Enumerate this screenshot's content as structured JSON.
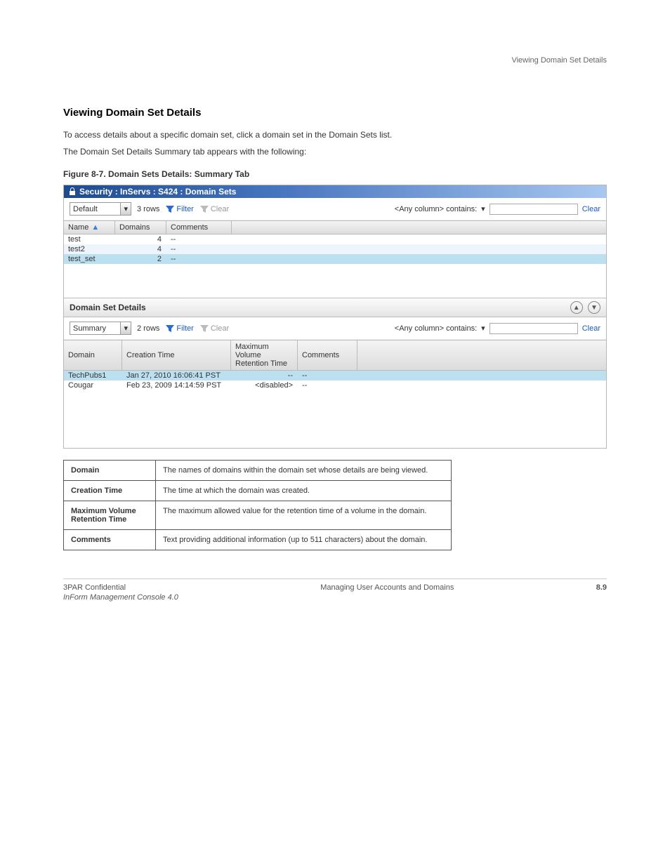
{
  "header": {
    "right": "Viewing Domain Set Details"
  },
  "section": {
    "title": "Viewing Domain Set Details",
    "p1": "To access details about a specific domain set, click a domain set in the Domain Sets list.",
    "p2": "The Domain Set Details Summary tab appears with the following:",
    "figcap": "Figure 8-7.  Domain Sets Details: Summary Tab"
  },
  "panel1": {
    "titlebar": "Security : InServs : S424 : Domain Sets",
    "dropdown": "Default",
    "rows": "3 rows",
    "filter": "Filter",
    "clear": "Clear",
    "filterLabel": "<Any column> contains:",
    "clearLink": "Clear",
    "cols": [
      "Name",
      "Domains",
      "Comments"
    ],
    "data": [
      {
        "name": "test",
        "domains": "4",
        "comments": "--"
      },
      {
        "name": "test2",
        "domains": "4",
        "comments": "--"
      },
      {
        "name": "test_set",
        "domains": "2",
        "comments": "--"
      }
    ]
  },
  "details": {
    "title": "Domain Set Details"
  },
  "panel2": {
    "dropdown": "Summary",
    "rows": "2 rows",
    "filter": "Filter",
    "clear": "Clear",
    "filterLabel": "<Any column> contains:",
    "clearLink": "Clear",
    "cols": [
      "Domain",
      "Creation Time",
      "Maximum Volume Retention Time",
      "Comments"
    ],
    "data": [
      {
        "domain": "TechPubs1",
        "ct": "Jan 27, 2010 16:06:41 PST",
        "mv": "--",
        "cm": "--"
      },
      {
        "domain": "Cougar",
        "ct": "Feb 23, 2009 14:14:59 PST",
        "mv": "<disabled>",
        "cm": "--"
      }
    ]
  },
  "docTable": {
    "rows": [
      [
        "Domain",
        "The names of domains within the domain set whose details are being viewed."
      ],
      [
        "Creation Time",
        "The time at which the domain was created."
      ],
      [
        "Maximum Volume Retention Time",
        "The maximum allowed value for the retention time of a volume in the domain."
      ],
      [
        "Comments",
        "Text providing additional information (up to 511 characters) about the domain."
      ]
    ]
  },
  "footer": {
    "left": "3PAR Confidential",
    "mid": "Managing User Accounts and Domains",
    "right": "8.9",
    "rev": "InForm Management Console 4.0"
  }
}
